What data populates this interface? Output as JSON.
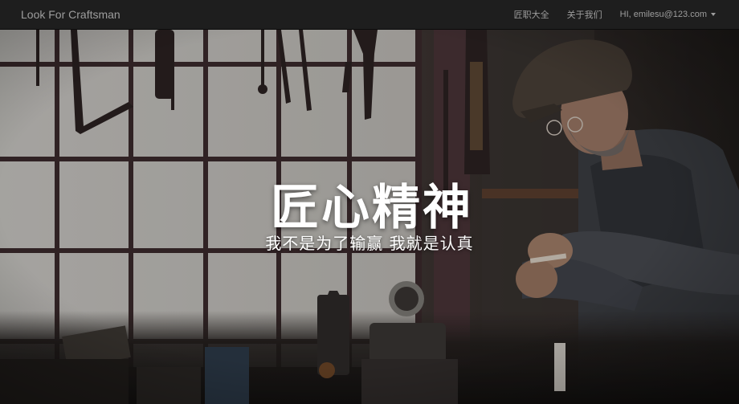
{
  "navbar": {
    "brand": "Look For Craftsman",
    "links": [
      {
        "label": "匠职大全"
      },
      {
        "label": "关于我们"
      }
    ],
    "user": {
      "label": "HI, emilesu@123.com",
      "icon": "caret-down-icon"
    }
  },
  "hero": {
    "title": "匠心精神",
    "subtitle": "我不是为了输赢 我就是认真",
    "image_subject": "craftsman working in a workshop with tools hanging on a window"
  },
  "colors": {
    "navbar_bg": "#1e1e1e",
    "nav_text": "#9d9d9d",
    "hero_text": "#ffffff"
  }
}
